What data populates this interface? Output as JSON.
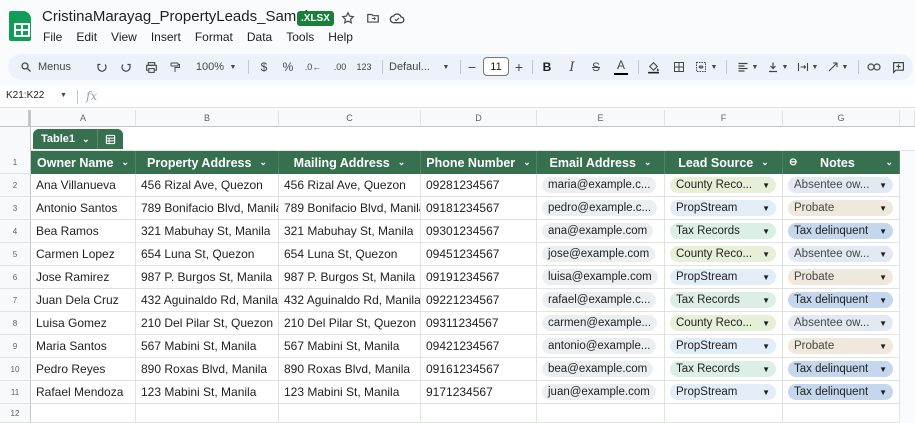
{
  "app": {
    "doc_title": "CristinaMarayag_PropertyLeads_Sample",
    "file_badge": ".XLSX",
    "menu": [
      "File",
      "Edit",
      "View",
      "Insert",
      "Format",
      "Data",
      "Tools",
      "Help"
    ]
  },
  "toolbar": {
    "menus_label": "Menus",
    "zoom": "100%",
    "currency": "$",
    "percent": "%",
    "dec_decrease": ".0←",
    "dec_increase": ".00",
    "number_format": "123",
    "font": "Defaul...",
    "font_size": "11"
  },
  "formula_bar": {
    "name_box": "K21:K22",
    "fx": "fx",
    "content": ""
  },
  "grid": {
    "column_letters": [
      "A",
      "B",
      "C",
      "D",
      "E",
      "F",
      "G"
    ],
    "row_numbers": [
      "1",
      "2",
      "3",
      "4",
      "5",
      "6",
      "7",
      "8",
      "9",
      "10",
      "11",
      "12"
    ]
  },
  "table": {
    "name": "Table1",
    "headers": [
      "Owner Name",
      "Property Address",
      "Mailing Address",
      "Phone Number",
      "Email Address",
      "Lead Source",
      "Notes"
    ],
    "rows": [
      [
        "Ana Villanueva",
        "456 Rizal Ave, Quezon",
        "456 Rizal Ave, Quezon",
        "09281234567",
        "maria@example.c...",
        "County Reco...",
        "Absentee ow..."
      ],
      [
        "Antonio Santos",
        "789 Bonifacio Blvd, Manila",
        "789 Bonifacio Blvd, Manila",
        "09181234567",
        "pedro@example.c...",
        "PropStream",
        "Probate"
      ],
      [
        "Bea Ramos",
        "321 Mabuhay St, Manila",
        "321 Mabuhay St, Manila",
        "09301234567",
        "ana@example.com",
        "Tax Records",
        "Tax delinquent"
      ],
      [
        "Carmen Lopez",
        "654 Luna St, Quezon",
        "654 Luna St, Quezon",
        "09451234567",
        "jose@example.com",
        "County Reco...",
        "Absentee ow..."
      ],
      [
        "Jose Ramirez",
        "987 P. Burgos St, Manila",
        "987 P. Burgos St, Manila",
        "09191234567",
        "luisa@example.com",
        "PropStream",
        "Probate"
      ],
      [
        "Juan Dela Cruz",
        "432 Aguinaldo Rd, Manila",
        "432 Aguinaldo Rd, Manila",
        "09221234567",
        "rafael@example.c...",
        "Tax Records",
        "Tax delinquent"
      ],
      [
        "Luisa Gomez",
        "210 Del Pilar St, Quezon",
        "210 Del Pilar St, Quezon",
        "09311234567",
        "carmen@example...",
        "County Reco...",
        "Absentee ow..."
      ],
      [
        "Maria Santos",
        "567 Mabini St, Manila",
        "567 Mabini St, Manila",
        "09421234567",
        "antonio@example...",
        "PropStream",
        "Probate"
      ],
      [
        "Pedro Reyes",
        "890 Roxas Blvd, Manila",
        "890 Roxas Blvd, Manila",
        "09161234567",
        "bea@example.com",
        "Tax Records",
        "Tax delinquent"
      ],
      [
        "Rafael Mendoza",
        "123 Mabini St, Manila",
        "123 Mabini St, Manila",
        "9171234567",
        "juan@example.com",
        "PropStream",
        "Tax delinquent"
      ]
    ]
  },
  "colors": {
    "header_green": "#36704f",
    "county_chip": "#e6efd7",
    "propstream_chip": "#e3edf7",
    "taxrecords_chip": "#dcefe6",
    "absentee_chip": "#e3e9f2",
    "probate_chip": "#efe8dc",
    "taxdelinquent_chip": "#c4d7ec",
    "email_chip": "#eceff1"
  }
}
